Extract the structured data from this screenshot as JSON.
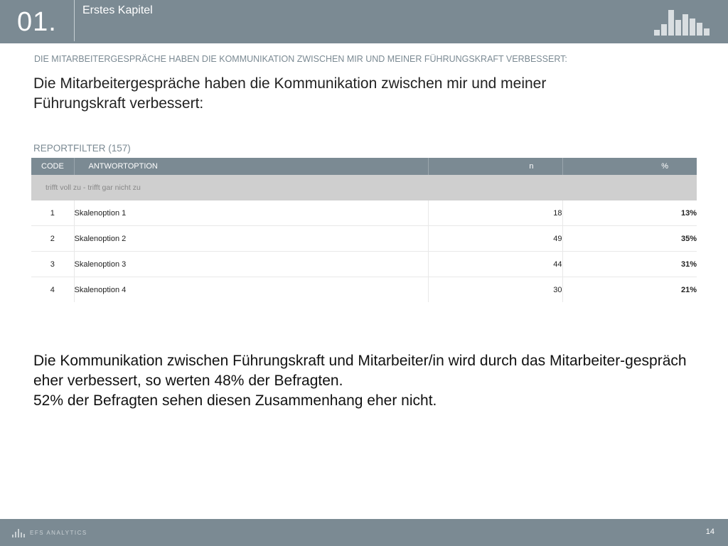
{
  "header": {
    "chapter_number": "01.",
    "chapter_title": "Erstes Kapitel",
    "logo_icon": "bar-chart-icon"
  },
  "subtitle": "DIE MITARBEITERGESPRÄCHE HABEN DIE KOMMUNIKATION ZWISCHEN MIR UND MEINER FÜHRUNGSKRAFT VERBESSERT:",
  "question": "Die Mitarbeitergespräche haben die Kommunikation zwischen mir und meiner Führungskraft verbessert:",
  "filter_label": "REPORTFILTER (157)",
  "table": {
    "headers": {
      "code": "CODE",
      "option": "ANTWORTOPTION",
      "n": "n",
      "percent": "%"
    },
    "group_label": "trifft voll zu - trifft gar nicht zu",
    "rows": [
      {
        "code": "1",
        "option": "Skalenoption 1",
        "n": "18",
        "percent": "13%"
      },
      {
        "code": "2",
        "option": "Skalenoption 2",
        "n": "49",
        "percent": "35%"
      },
      {
        "code": "3",
        "option": "Skalenoption 3",
        "n": "44",
        "percent": "31%"
      },
      {
        "code": "4",
        "option": "Skalenoption 4",
        "n": "30",
        "percent": "21%"
      }
    ]
  },
  "conclusion": {
    "line1": "Die Kommunikation zwischen Führungskraft und Mitarbeiter/in wird durch das Mitarbeiter-gespräch eher verbessert, so werten 48% der Befragten.",
    "line2": "52% der Befragten sehen diesen Zusammenhang eher nicht."
  },
  "footer": {
    "brand": "EFS ANALYTICS",
    "page_number": "14"
  },
  "colors": {
    "header_bg": "#7b8a93",
    "group_row_bg": "#cfcfcf",
    "accent_text": "#7b8a93"
  }
}
